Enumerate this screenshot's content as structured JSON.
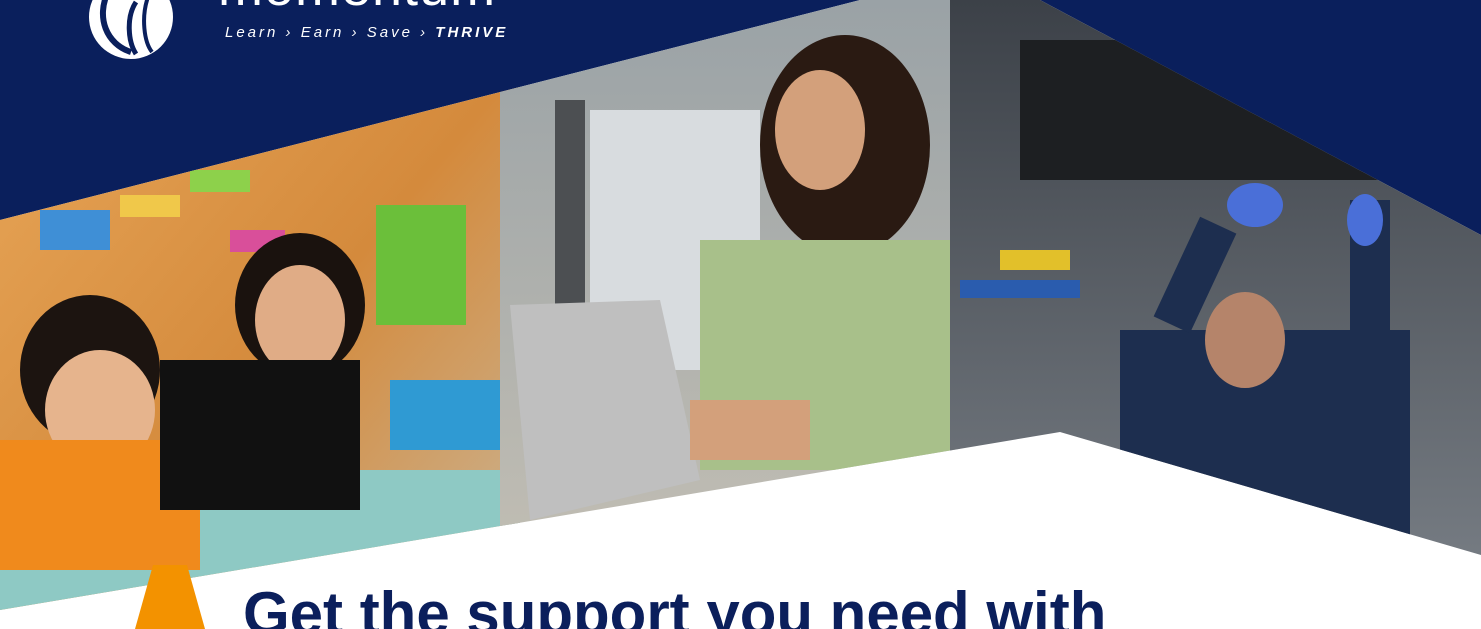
{
  "brand": {
    "name": "momentum",
    "tagline": {
      "learn": "Learn",
      "earn": "Earn",
      "save": "Save",
      "thrive": "THRIVE",
      "separator": "›"
    }
  },
  "photos": [
    {
      "subject": "teacher-with-child",
      "icon": "classroom-photo"
    },
    {
      "subject": "woman-with-laptop",
      "icon": "office-photo"
    },
    {
      "subject": "mechanic-under-car",
      "icon": "garage-photo"
    }
  ],
  "headline": "Get the support you need with",
  "colors": {
    "navy": "#0a1f5c",
    "orange": "#f39200",
    "white": "#ffffff"
  }
}
